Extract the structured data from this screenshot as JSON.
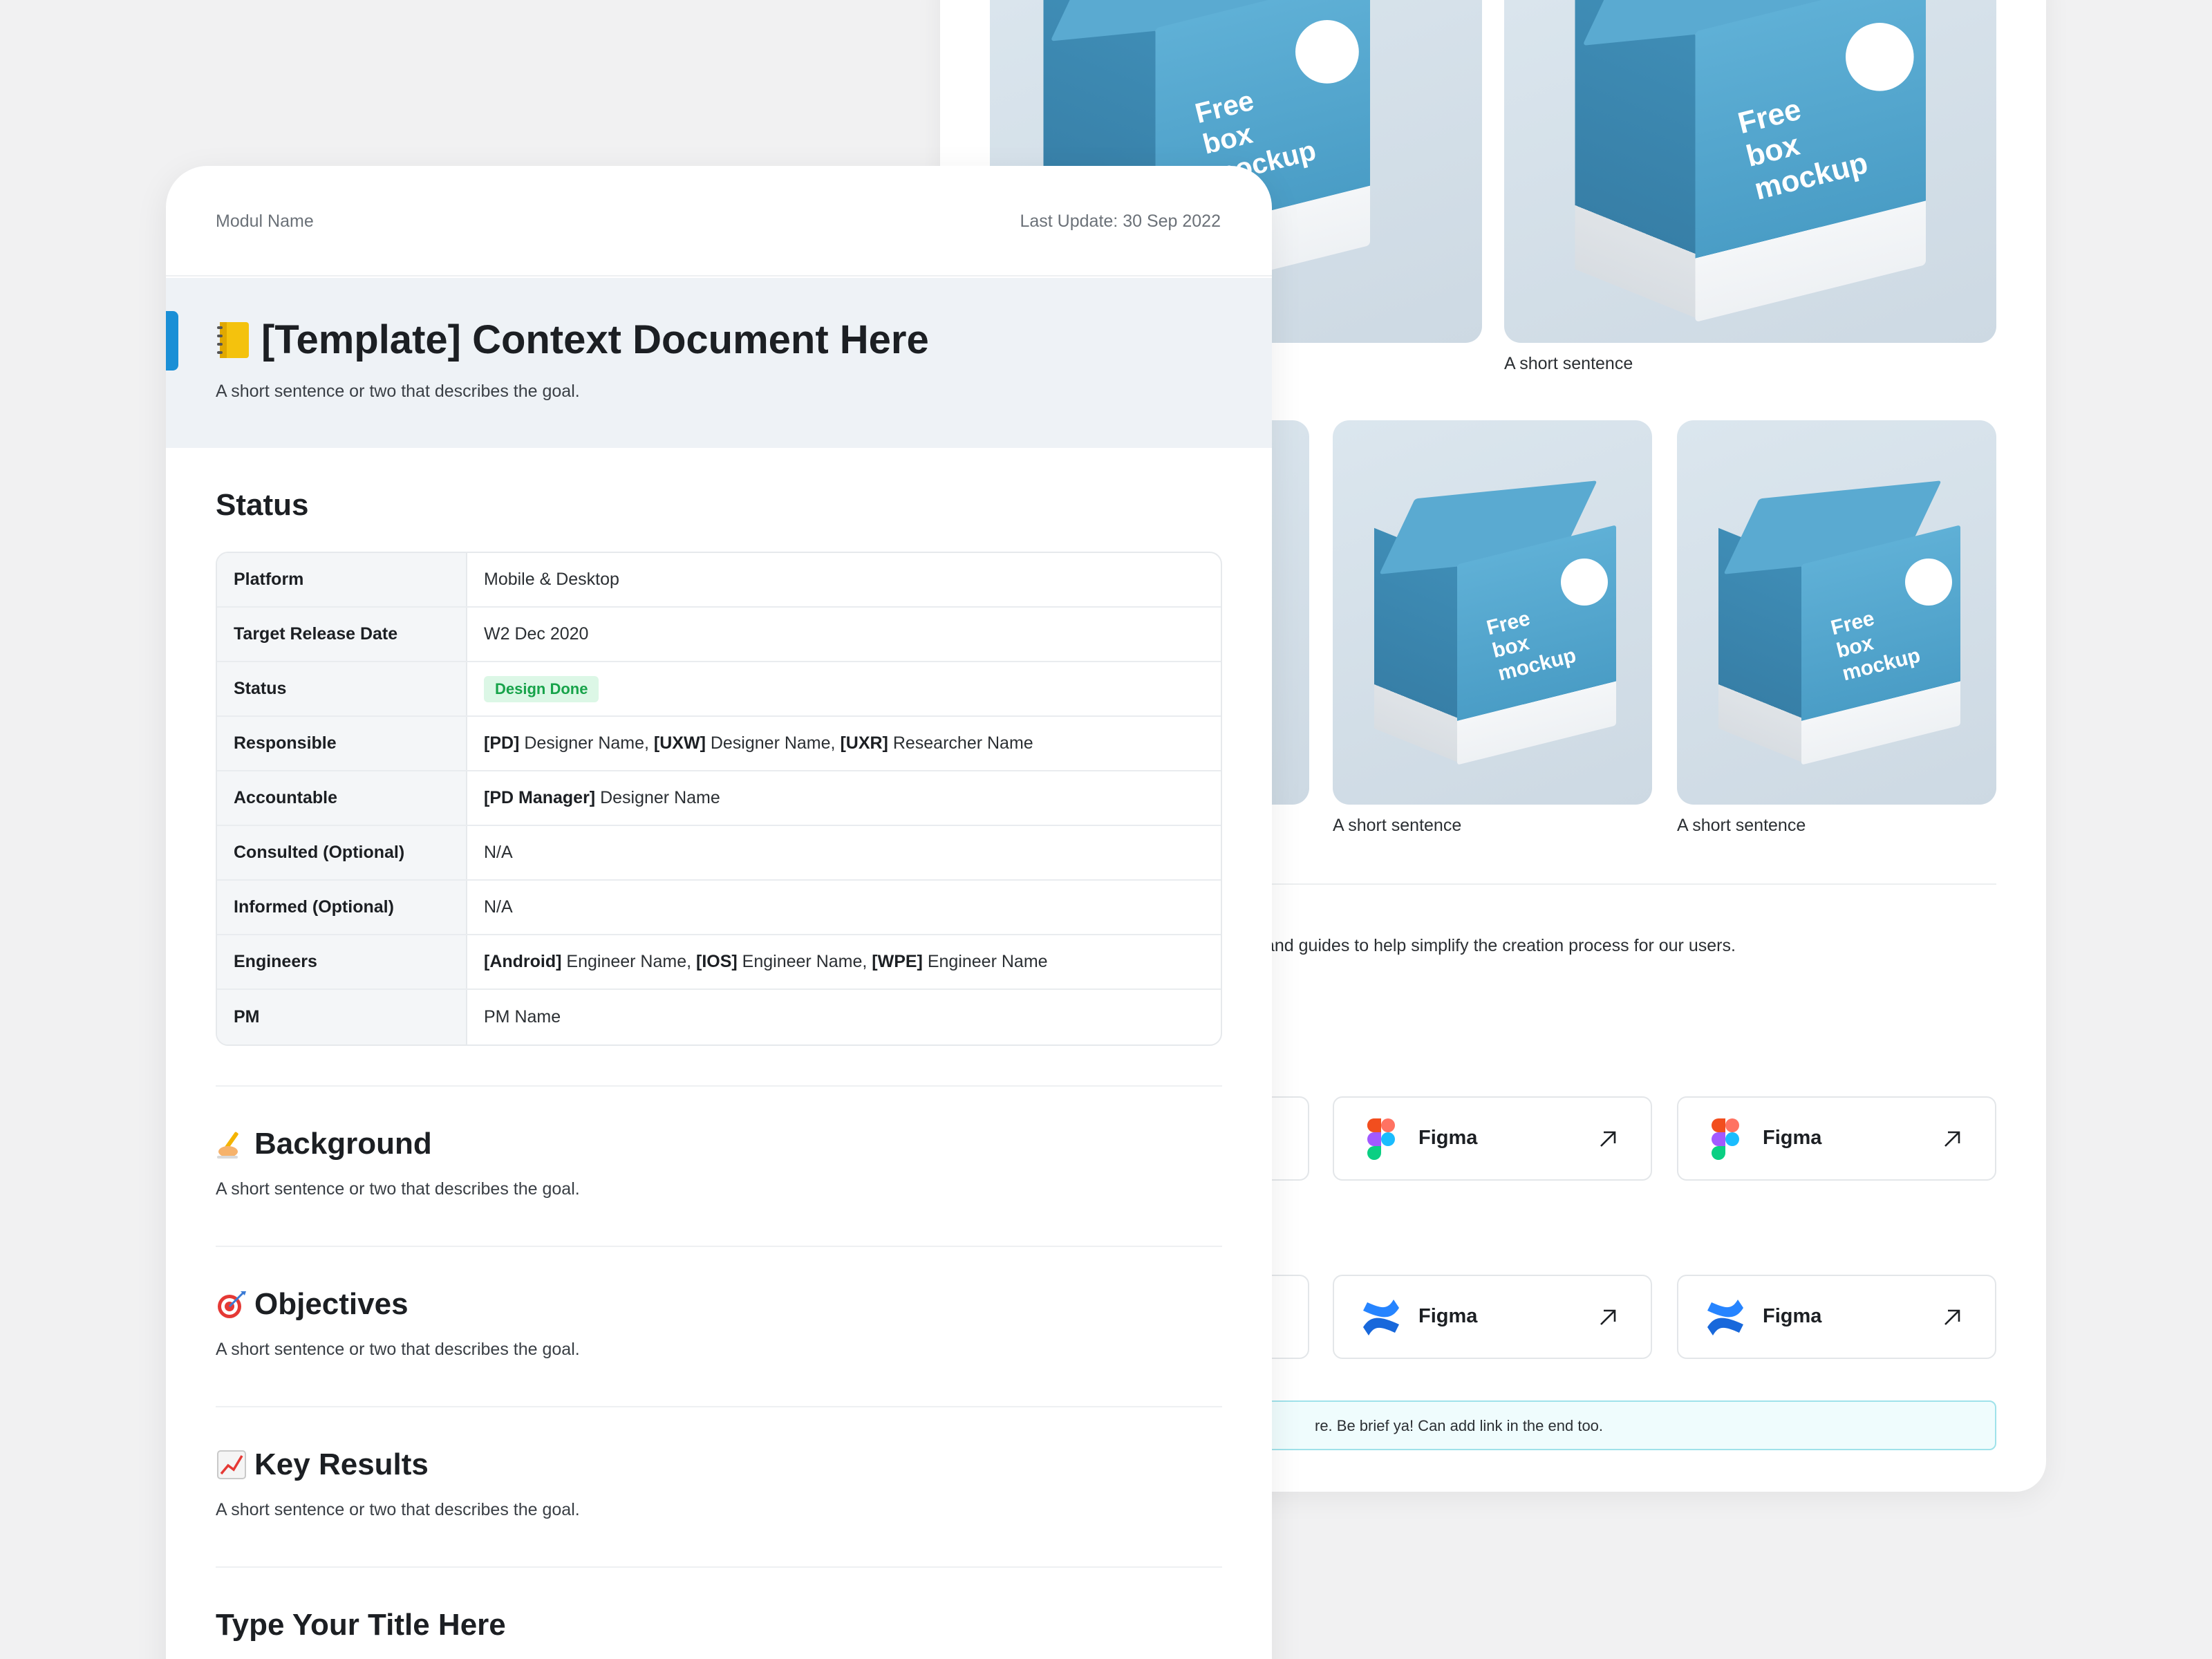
{
  "back_card": {
    "gallery": {
      "captions": [
        "A short sentence",
        "A short sentence",
        "A short sentence"
      ],
      "box_text": [
        "Free",
        "box",
        "mockup"
      ],
      "box_url": "mockups-design.com"
    },
    "resources_text": "and guides to help simplify the creation process for our users.",
    "tools_row1": [
      {
        "label": "Figma",
        "icon": "figma-icon"
      },
      {
        "label": "Figma",
        "icon": "figma-icon"
      }
    ],
    "tools_row2": [
      {
        "label": "Figma",
        "icon": "confluence-icon"
      },
      {
        "label": "Figma",
        "icon": "confluence-icon"
      }
    ],
    "callout_text": "re. Be brief ya! Can add link in the end too.",
    "accent_color": "#1a8fd6"
  },
  "front_card": {
    "module_name": "Modul Name",
    "last_update": "Last Update: 30 Sep 2022",
    "title": "[Template] Context Document Here",
    "title_icon": "notebook-icon",
    "subtitle": "A short sentence or two that describes the goal.",
    "status_heading": "Status",
    "status_rows": [
      {
        "key": "Platform",
        "value": "Mobile & Desktop"
      },
      {
        "key": "Target Release Date",
        "value": "W2 Dec 2020"
      },
      {
        "key": "Status",
        "badge": "Design Done",
        "badge_color": "#17a34a"
      },
      {
        "key": "Responsible",
        "parts": [
          [
            "[PD]",
            " Designer Name, "
          ],
          [
            "[UXW]",
            " Designer Name, "
          ],
          [
            "[UXR]",
            " Researcher Name"
          ]
        ]
      },
      {
        "key": "Accountable",
        "parts": [
          [
            "[PD Manager]",
            " Designer Name"
          ]
        ]
      },
      {
        "key": "Consulted (Optional)",
        "value": "N/A"
      },
      {
        "key": "Informed (Optional)",
        "value": "N/A"
      },
      {
        "key": "Engineers",
        "parts": [
          [
            "[Android]",
            " Engineer Name, "
          ],
          [
            "[IOS]",
            " Engineer Name, "
          ],
          [
            "[WPE]",
            " Engineer Name"
          ]
        ]
      },
      {
        "key": "PM",
        "value": "PM Name"
      }
    ],
    "sections": [
      {
        "title": "Background",
        "icon": "writing-hand-icon",
        "desc": "A short sentence or two that describes the goal."
      },
      {
        "title": "Objectives",
        "icon": "target-icon",
        "desc": "A short sentence or two that describes the goal."
      },
      {
        "title": "Key Results",
        "icon": "chart-up-icon",
        "desc": "A short sentence or two that describes the goal."
      }
    ],
    "last_heading": "Type Your Title Here"
  }
}
